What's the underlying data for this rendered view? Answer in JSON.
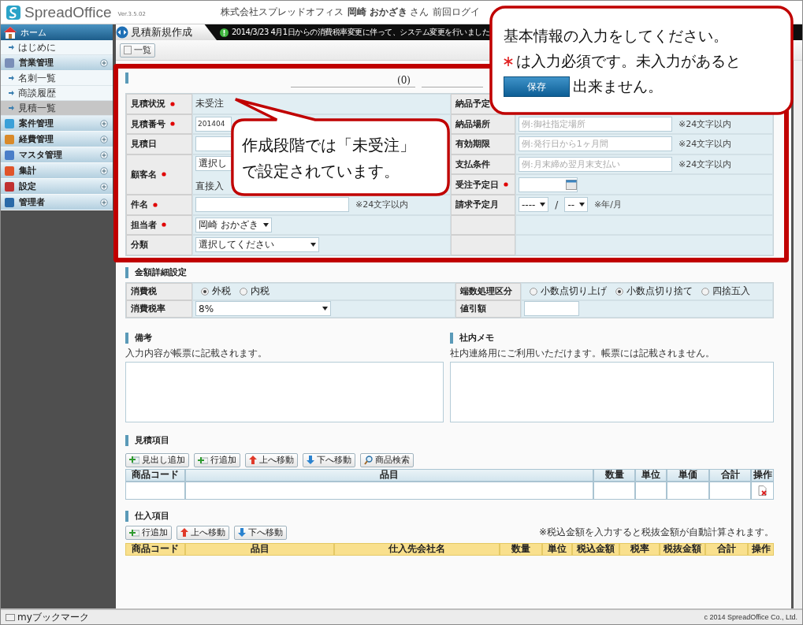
{
  "header": {
    "logo": "SpreadOffice",
    "version": "Ver.3.5.02",
    "company": "株式会社スプレッドオフィス",
    "user": "岡崎 おかざき",
    "honorific": "さん",
    "last_login": "前回ログイ"
  },
  "sidebar": {
    "home": "ホーム",
    "items": [
      {
        "kind": "link",
        "label": "はじめに",
        "selected": false
      },
      {
        "kind": "group",
        "label": "営業管理"
      },
      {
        "kind": "link",
        "label": "名刺一覧",
        "selected": false
      },
      {
        "kind": "link",
        "label": "商談履歴",
        "selected": false
      },
      {
        "kind": "link",
        "label": "見積一覧",
        "selected": true
      },
      {
        "kind": "group",
        "label": "案件管理"
      },
      {
        "kind": "group",
        "label": "経費管理"
      },
      {
        "kind": "group",
        "label": "マスタ管理"
      },
      {
        "kind": "group",
        "label": "集計"
      },
      {
        "kind": "group",
        "label": "設定"
      },
      {
        "kind": "group",
        "label": "管理者"
      }
    ]
  },
  "page_tab": "見積新規作成",
  "notice": "2014/3/23  4月1日からの消費税率変更に伴って、システム変更を行いました",
  "toolbar": {
    "list_button": "一覧"
  },
  "estimate": {
    "amount": "(0)",
    "left": [
      {
        "kind": "text",
        "label": "見積状況",
        "required": true,
        "value": "未受注"
      },
      {
        "kind": "input",
        "label": "見積番号",
        "required": true,
        "value": "201404"
      },
      {
        "kind": "input",
        "label": "見積日",
        "required": false
      },
      {
        "kind": "customer",
        "label": "顧客名",
        "required": true,
        "value": "選択し",
        "note": "直接入"
      },
      {
        "kind": "input",
        "label": "件名",
        "required": true,
        "note": "※24文字以内"
      },
      {
        "kind": "select",
        "label": "担当者",
        "required": true,
        "value": "岡崎 おかざき"
      },
      {
        "kind": "select",
        "label": "分類",
        "required": false,
        "value": "選択してください"
      }
    ],
    "right": [
      {
        "kind": "covered",
        "label": "納品予定",
        "required": false
      },
      {
        "kind": "input",
        "label": "納品場所",
        "required": false,
        "placeholder": "例:御社指定場所",
        "note": "※24文字以内"
      },
      {
        "kind": "input",
        "label": "有効期限",
        "required": false,
        "placeholder": "例:発行日から1ヶ月間",
        "note": "※24文字以内"
      },
      {
        "kind": "input",
        "label": "支払条件",
        "required": false,
        "placeholder": "例:月末締め翌月末支払い",
        "note": "※24文字以内"
      },
      {
        "kind": "date",
        "label": "受注予定日",
        "required": true
      },
      {
        "kind": "month",
        "label": "請求予定月",
        "required": false,
        "year": "----",
        "separator": "/",
        "month": "--",
        "note": "※年/月"
      },
      {
        "kind": "empty"
      },
      {
        "kind": "empty"
      }
    ]
  },
  "amount_settings": {
    "title": "金額詳細設定",
    "rows": [
      [
        {
          "kind": "radios",
          "label": "消費税",
          "options": [
            {
              "label": "外税",
              "selected": true
            },
            {
              "label": "内税",
              "selected": false
            }
          ]
        },
        {
          "kind": "radios",
          "label": "端数処理区分",
          "options": [
            {
              "label": "小数点切り上げ",
              "selected": false
            },
            {
              "label": "小数点切り捨て",
              "selected": true
            },
            {
              "label": "四捨五入",
              "selected": false
            }
          ]
        }
      ],
      [
        {
          "kind": "select",
          "label": "消費税率",
          "value": "8%"
        },
        {
          "kind": "input",
          "label": "値引額"
        }
      ]
    ]
  },
  "notes": [
    {
      "title": "備考",
      "description": "入力内容が帳票に記載されます。"
    },
    {
      "title": "社内メモ",
      "description": "社内連絡用にご利用いただけます。帳票には記載されません。"
    }
  ],
  "estimate_items": {
    "title": "見積項目",
    "buttons": [
      {
        "kind": "heading",
        "label": "見出し追加"
      },
      {
        "kind": "add",
        "label": "行追加"
      },
      {
        "kind": "up",
        "label": "上へ移動"
      },
      {
        "kind": "down",
        "label": "下へ移動"
      },
      {
        "kind": "search",
        "label": "商品検索"
      }
    ],
    "columns": [
      "商品コード",
      "品目",
      "数量",
      "単位",
      "単価",
      "合計",
      "操作"
    ]
  },
  "purchase_items": {
    "title": "仕入項目",
    "buttons": [
      {
        "kind": "add",
        "label": "行追加"
      },
      {
        "kind": "up",
        "label": "上へ移動"
      },
      {
        "kind": "down",
        "label": "下へ移動"
      }
    ],
    "note": "※税込金額を入力すると税抜金額が自動計算されます。",
    "columns": [
      "商品コード",
      "品目",
      "仕入先会社名",
      "数量",
      "単位",
      "税込金額",
      "税率",
      "税抜金額",
      "合計",
      "操作"
    ]
  },
  "footer": {
    "bookmark": "myブックマーク",
    "copyright": "c 2014 SpreadOffice Co., Ltd."
  },
  "status_callout": {
    "lines": [
      "作成段階では「未受注」",
      "で設定されています。"
    ]
  },
  "info_callout": {
    "line_1": "基本情報の入力をしてください。",
    "line_2": "は入力必須です。未入力があると",
    "save_button": "保存",
    "line_3": "出来ません。"
  }
}
